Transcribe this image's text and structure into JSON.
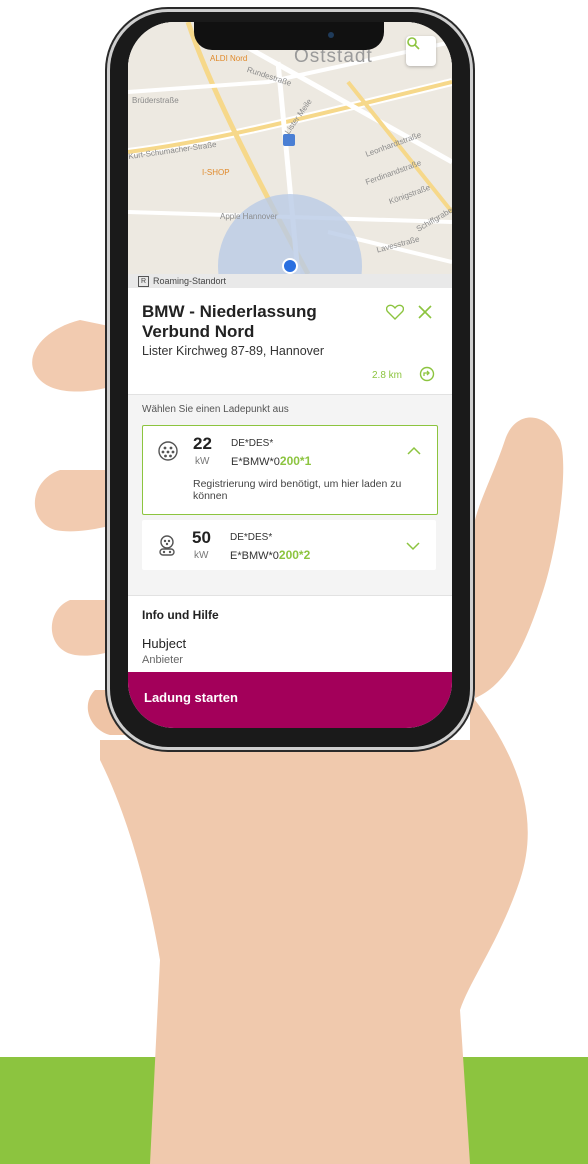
{
  "map": {
    "district": "Oststadt",
    "poi_labels": [
      "ALDI Nord",
      "I-SHOP",
      "Apple Hannover"
    ],
    "street_labels": [
      "Rundestraße",
      "Brüderstraße",
      "Kurt-Schumacher-Straße",
      "Lister Meile",
      "Leonhardtstraße",
      "Ferdinandstraße",
      "Königstraße",
      "Lavesstraße",
      "Schiffgraben"
    ]
  },
  "roaming": {
    "badge": "R",
    "label": "Roaming-Standort"
  },
  "station": {
    "name": "BMW - Niederlassung Verbund Nord",
    "address": "Lister Kirchweg 87-89, Hannover",
    "distance": "2.8 km"
  },
  "chargepoints": {
    "heading": "Wählen Sie einen Ladepunkt aus",
    "items": [
      {
        "power": "22",
        "unit": "kW",
        "operator": "DE*DES*",
        "evse_prefix": "E*BMW*0",
        "evse_highlight": "200*1",
        "note": "Registrierung wird benötigt, um hier laden zu können"
      },
      {
        "power": "50",
        "unit": "kW",
        "operator": "DE*DES*",
        "evse_prefix": "E*BMW*0",
        "evse_highlight": "200*2"
      }
    ]
  },
  "info": {
    "title": "Info und Hilfe",
    "provider": "Hubject",
    "provider_role": "Anbieter"
  },
  "cta": {
    "label": "Ladung starten"
  },
  "colors": {
    "accent_green": "#8cc43f",
    "cta_magenta": "#a3005a"
  }
}
